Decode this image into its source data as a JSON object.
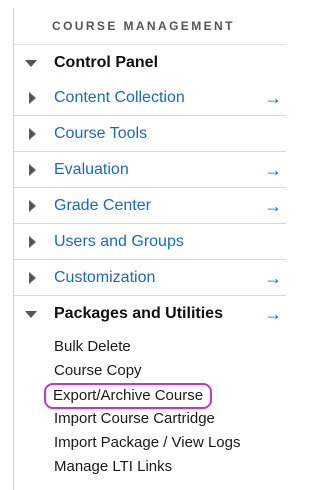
{
  "section_title": "COURSE MANAGEMENT",
  "control_panel": {
    "label": "Control Panel"
  },
  "items": [
    {
      "label": "Content Collection",
      "arrow": "→"
    },
    {
      "label": "Course Tools",
      "arrow": ""
    },
    {
      "label": "Evaluation",
      "arrow": "→"
    },
    {
      "label": "Grade Center",
      "arrow": "→"
    },
    {
      "label": "Users and Groups",
      "arrow": ""
    },
    {
      "label": "Customization",
      "arrow": "→"
    }
  ],
  "packages": {
    "label": "Packages and Utilities",
    "arrow": "→",
    "subitems": [
      "Bulk Delete",
      "Course Copy",
      "Export/Archive Course",
      "Import Course Cartridge",
      "Import Package / View Logs",
      "Manage LTI Links"
    ]
  },
  "colors": {
    "link": "#1f69b3",
    "highlight": "#c832d2"
  },
  "icons": {
    "collapsed": "triangle-right-icon",
    "expanded": "triangle-down-icon",
    "launch": "arrow-right-icon"
  }
}
